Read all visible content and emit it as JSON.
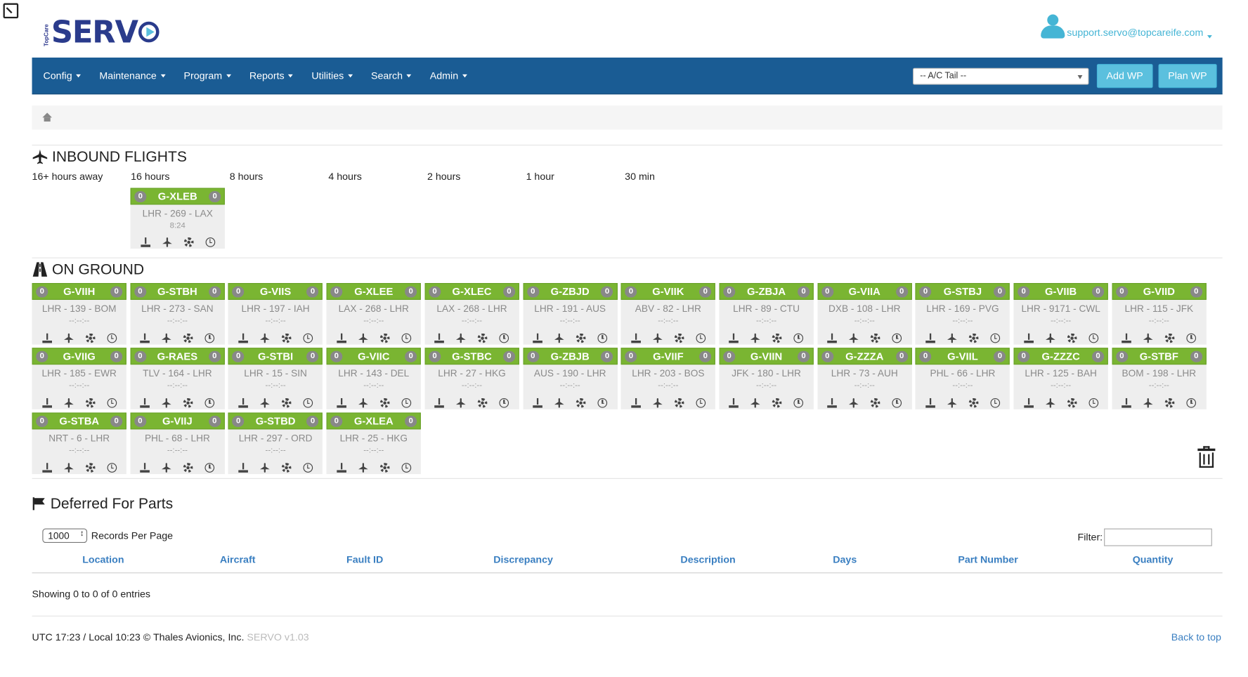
{
  "logo": {
    "small": "TopCare",
    "brand": "SERV"
  },
  "user": {
    "email": "support.servo@topcareife.com"
  },
  "nav": {
    "items": [
      "Config",
      "Maintenance",
      "Program",
      "Reports",
      "Utilities",
      "Search",
      "Admin"
    ],
    "tail_select": "-- A/C Tail --",
    "add_wp": "Add WP",
    "plan_wp": "Plan WP"
  },
  "inbound": {
    "title": "INBOUND FLIGHTS",
    "hours": [
      "16+ hours away",
      "16 hours",
      "8 hours",
      "4 hours",
      "2 hours",
      "1 hour",
      "30 min"
    ],
    "flights": [
      {
        "left": "0",
        "tail": "G-XLEB",
        "right": "0",
        "route": "LHR - 269 - LAX",
        "eta": "8:24"
      }
    ]
  },
  "on_ground": {
    "title": "ON GROUND",
    "tiles": [
      {
        "tail": "G-VIIH",
        "route": "LHR - 139 - BOM"
      },
      {
        "tail": "G-STBH",
        "route": "LHR - 273 - SAN"
      },
      {
        "tail": "G-VIIS",
        "route": "LHR - 197 - IAH"
      },
      {
        "tail": "G-XLEE",
        "route": "LAX - 268 - LHR"
      },
      {
        "tail": "G-XLEC",
        "route": "LAX - 268 - LHR"
      },
      {
        "tail": "G-ZBJD",
        "route": "LHR - 191 - AUS"
      },
      {
        "tail": "G-VIIK",
        "route": "ABV - 82 - LHR"
      },
      {
        "tail": "G-ZBJA",
        "route": "LHR - 89 - CTU"
      },
      {
        "tail": "G-VIIA",
        "route": "DXB - 108 - LHR"
      },
      {
        "tail": "G-STBJ",
        "route": "LHR - 169 - PVG"
      },
      {
        "tail": "G-VIIB",
        "route": "LHR - 9171 - CWL"
      },
      {
        "tail": "G-VIID",
        "route": "LHR - 115 - JFK"
      },
      {
        "tail": "G-VIIG",
        "route": "LHR - 185 - EWR"
      },
      {
        "tail": "G-RAES",
        "route": "TLV - 164 - LHR"
      },
      {
        "tail": "G-STBI",
        "route": "LHR - 15 - SIN"
      },
      {
        "tail": "G-VIIC",
        "route": "LHR - 143 - DEL"
      },
      {
        "tail": "G-STBC",
        "route": "LHR - 27 - HKG"
      },
      {
        "tail": "G-ZBJB",
        "route": "AUS - 190 - LHR"
      },
      {
        "tail": "G-VIIF",
        "route": "LHR - 203 - BOS"
      },
      {
        "tail": "G-VIIN",
        "route": "JFK - 180 - LHR"
      },
      {
        "tail": "G-ZZZA",
        "route": "LHR - 73 - AUH"
      },
      {
        "tail": "G-VIIL",
        "route": "PHL - 66 - LHR"
      },
      {
        "tail": "G-ZZZC",
        "route": "LHR - 125 - BAH"
      },
      {
        "tail": "G-STBF",
        "route": "BOM - 198 - LHR"
      },
      {
        "tail": "G-STBA",
        "route": "NRT - 6 - LHR"
      },
      {
        "tail": "G-VIIJ",
        "route": "PHL - 68 - LHR"
      },
      {
        "tail": "G-STBD",
        "route": "LHR - 297 - ORD"
      },
      {
        "tail": "G-XLEA",
        "route": "LHR - 25 - HKG"
      }
    ],
    "badge": "0",
    "eta": "--:--:--"
  },
  "deferred": {
    "title": "Deferred For Parts",
    "per_page_value": "1000",
    "per_page_label": "Records Per Page",
    "filter_label": "Filter:",
    "columns": [
      "Location",
      "Aircraft",
      "Fault ID",
      "Discrepancy",
      "Description",
      "Days",
      "Part Number",
      "Quantity"
    ],
    "info": "Showing 0 to 0 of 0 entries"
  },
  "footer": {
    "text": "UTC 17:23 / Local 10:23 © Thales Avionics, Inc.",
    "version": "SERVO v1.03",
    "back_to_top": "Back to top"
  },
  "colors": {
    "navbar": "#1a5c94",
    "accent": "#5bc0de",
    "tile_green": "#7ab532",
    "link": "#3a7fc1"
  }
}
